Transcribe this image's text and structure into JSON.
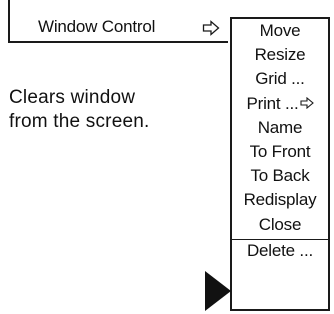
{
  "parent_menu": {
    "item_label": "Window Control",
    "item_arrow_icon": "hollow-right-arrow-icon"
  },
  "description": {
    "line1": "Clears  window",
    "line2": "from the screen."
  },
  "submenu": {
    "items": [
      {
        "label": "Move",
        "has_submenu": false
      },
      {
        "label": "Resize",
        "has_submenu": false
      },
      {
        "label": "Grid ...",
        "has_submenu": false
      },
      {
        "label": "Print ...",
        "has_submenu": true
      },
      {
        "label": "Name",
        "has_submenu": false
      },
      {
        "label": "To Front",
        "has_submenu": false
      },
      {
        "label": "To Back",
        "has_submenu": false
      },
      {
        "label": "Redisplay",
        "has_submenu": false
      },
      {
        "label": "Close",
        "has_submenu": false
      },
      {
        "label": "Delete ...",
        "has_submenu": false,
        "selected": true
      }
    ]
  },
  "pointer_icon": "black-triangle-pointer-icon",
  "colors": {
    "ink": "#1a1a1a",
    "background": "#ffffff"
  }
}
